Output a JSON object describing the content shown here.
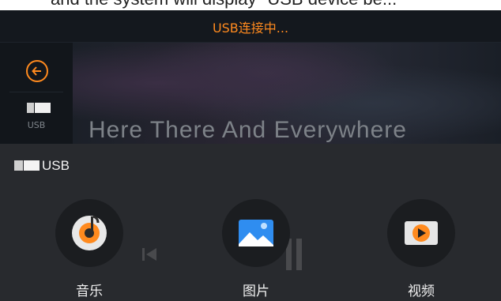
{
  "caption": "and the system will display \"USB device be...",
  "status": {
    "title": "USB连接中..."
  },
  "nav": {
    "back_icon": "arrow-left-circle-icon",
    "usb_label": "USB"
  },
  "now_playing": {
    "title": "Here There And Everywhere"
  },
  "sheet": {
    "source_label": "USB",
    "apps": [
      {
        "label": "音乐",
        "icon": "music-disc-icon"
      },
      {
        "label": "图片",
        "icon": "picture-icon"
      },
      {
        "label": "视频",
        "icon": "video-play-icon"
      }
    ]
  },
  "colors": {
    "accent": "#ff8a1e",
    "sheet": "#2a2c2f",
    "text": "#f2f2f2"
  }
}
